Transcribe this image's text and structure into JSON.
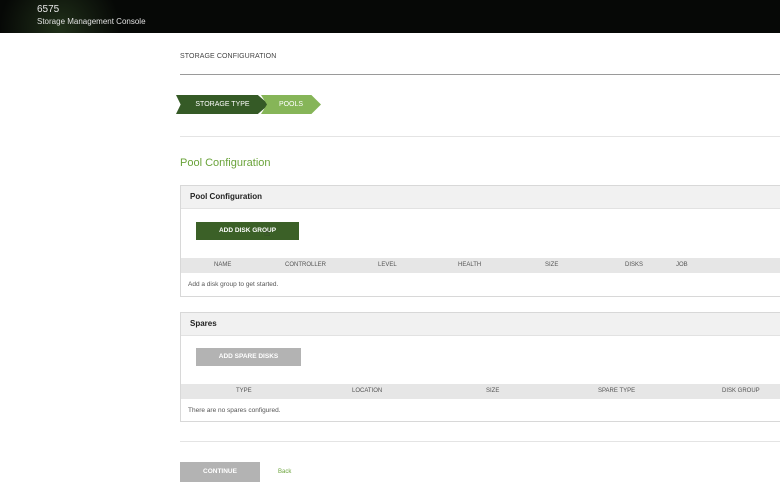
{
  "header": {
    "model": "6575",
    "console_title": "Storage Management Console"
  },
  "page": {
    "title": "STORAGE CONFIGURATION"
  },
  "wizard": {
    "steps": [
      {
        "label": "STORAGE TYPE",
        "state": "completed"
      },
      {
        "label": "POOLS",
        "state": "current"
      }
    ]
  },
  "section_heading": "Pool Configuration",
  "pool_panel": {
    "title": "Pool Configuration",
    "add_button": "ADD DISK GROUP",
    "columns": [
      "NAME",
      "CONTROLLER",
      "LEVEL",
      "HEALTH",
      "SIZE",
      "DISKS",
      "JOB"
    ],
    "empty_message": "Add a disk group to get started."
  },
  "spares_panel": {
    "title": "Spares",
    "add_button": "ADD SPARE DISKS",
    "columns": [
      "TYPE",
      "LOCATION",
      "SIZE",
      "SPARE TYPE",
      "DISK GROUP"
    ],
    "empty_message": "There are no spares configured."
  },
  "footer": {
    "continue_label": "CONTINUE",
    "back_label": "Back"
  },
  "colors": {
    "brand_dark_green": "#355a26",
    "brand_light_green": "#86b558",
    "accent_text_green": "#6aa33a",
    "disabled_gray": "#b3b3b3"
  }
}
